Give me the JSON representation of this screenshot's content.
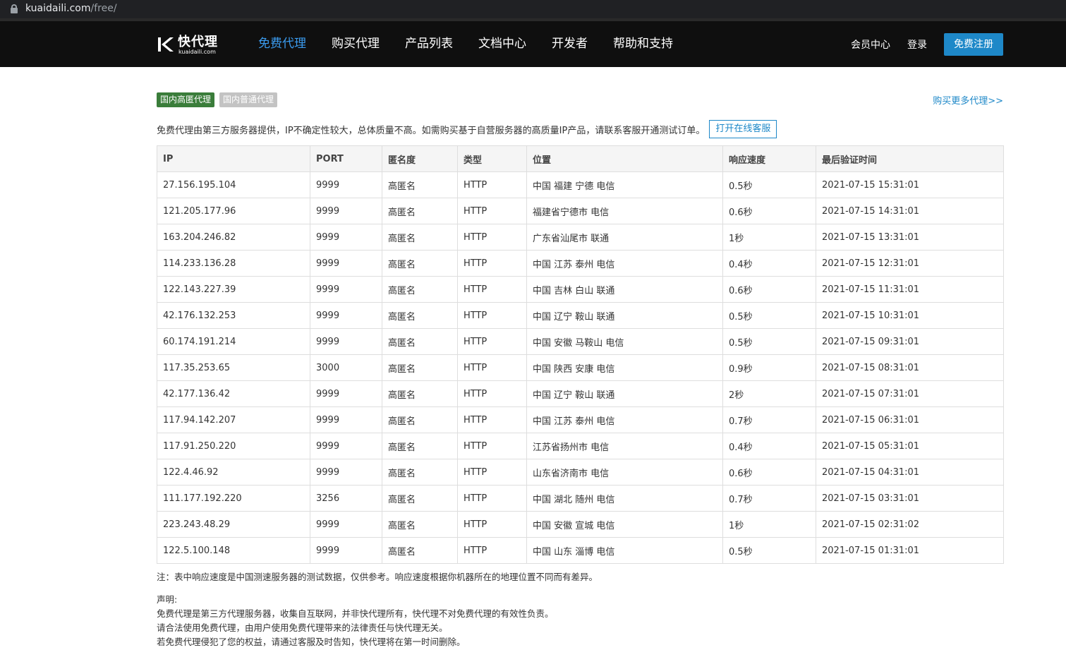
{
  "browser": {
    "url_host": "kuaidaili.com",
    "url_path": "/free/"
  },
  "header": {
    "logo_cn": "快代理",
    "logo_en": "kuaidaili.com",
    "nav": [
      "免费代理",
      "购买代理",
      "产品列表",
      "文档中心",
      "开发者",
      "帮助和支持"
    ],
    "member_center": "会员中心",
    "login": "登录",
    "register": "免费注册"
  },
  "tabs": {
    "high_anon": "国内高匿代理",
    "normal": "国内普通代理"
  },
  "buy_more": "购买更多代理>>",
  "notice": {
    "text": "免费代理由第三方服务器提供，IP不确定性较大，总体质量不高。如需购买基于自营服务器的高质量IP产品，请联系客服开通测试订单。",
    "button": "打开在线客服"
  },
  "table": {
    "headers": [
      "IP",
      "PORT",
      "匿名度",
      "类型",
      "位置",
      "响应速度",
      "最后验证时间"
    ],
    "rows": [
      [
        "27.156.195.104",
        "9999",
        "高匿名",
        "HTTP",
        "中国 福建 宁德 电信",
        "0.5秒",
        "2021-07-15 15:31:01"
      ],
      [
        "121.205.177.96",
        "9999",
        "高匿名",
        "HTTP",
        "福建省宁德市 电信",
        "0.6秒",
        "2021-07-15 14:31:01"
      ],
      [
        "163.204.246.82",
        "9999",
        "高匿名",
        "HTTP",
        "广东省汕尾市 联通",
        "1秒",
        "2021-07-15 13:31:01"
      ],
      [
        "114.233.136.28",
        "9999",
        "高匿名",
        "HTTP",
        "中国 江苏 泰州 电信",
        "0.4秒",
        "2021-07-15 12:31:01"
      ],
      [
        "122.143.227.39",
        "9999",
        "高匿名",
        "HTTP",
        "中国 吉林 白山 联通",
        "0.6秒",
        "2021-07-15 11:31:01"
      ],
      [
        "42.176.132.253",
        "9999",
        "高匿名",
        "HTTP",
        "中国 辽宁 鞍山 联通",
        "0.5秒",
        "2021-07-15 10:31:01"
      ],
      [
        "60.174.191.214",
        "9999",
        "高匿名",
        "HTTP",
        "中国 安徽 马鞍山 电信",
        "0.5秒",
        "2021-07-15 09:31:01"
      ],
      [
        "117.35.253.65",
        "3000",
        "高匿名",
        "HTTP",
        "中国 陕西 安康 电信",
        "0.9秒",
        "2021-07-15 08:31:01"
      ],
      [
        "42.177.136.42",
        "9999",
        "高匿名",
        "HTTP",
        "中国 辽宁 鞍山 联通",
        "2秒",
        "2021-07-15 07:31:01"
      ],
      [
        "117.94.142.207",
        "9999",
        "高匿名",
        "HTTP",
        "中国 江苏 泰州 电信",
        "0.7秒",
        "2021-07-15 06:31:01"
      ],
      [
        "117.91.250.220",
        "9999",
        "高匿名",
        "HTTP",
        "江苏省扬州市 电信",
        "0.4秒",
        "2021-07-15 05:31:01"
      ],
      [
        "122.4.46.92",
        "9999",
        "高匿名",
        "HTTP",
        "山东省济南市 电信",
        "0.6秒",
        "2021-07-15 04:31:01"
      ],
      [
        "111.177.192.220",
        "3256",
        "高匿名",
        "HTTP",
        "中国 湖北 随州 电信",
        "0.7秒",
        "2021-07-15 03:31:01"
      ],
      [
        "223.243.48.29",
        "9999",
        "高匿名",
        "HTTP",
        "中国 安徽 宣城 电信",
        "1秒",
        "2021-07-15 02:31:02"
      ],
      [
        "122.5.100.148",
        "9999",
        "高匿名",
        "HTTP",
        "中国 山东 淄博 电信",
        "0.5秒",
        "2021-07-15 01:31:01"
      ]
    ]
  },
  "footnote": "注：表中响应速度是中国测速服务器的测试数据，仅供参考。响应速度根据你机器所在的地理位置不同而有差异。",
  "declaration": [
    "声明:",
    "免费代理是第三方代理服务器，收集自互联网，并非快代理所有，快代理不对免费代理的有效性负责。",
    "请合法使用免费代理，由用户使用免费代理带来的法律责任与快代理无关。",
    "若免费代理侵犯了您的权益，请通过客服及时告知，快代理将在第一时间删除。"
  ],
  "colors": {
    "header_bg": "#0f0f0f",
    "nav_active": "#3b9cf0",
    "brand_blue": "#1e88c8",
    "tab_active": "#3a7d3a",
    "tab_inactive": "#c3c3c3"
  }
}
